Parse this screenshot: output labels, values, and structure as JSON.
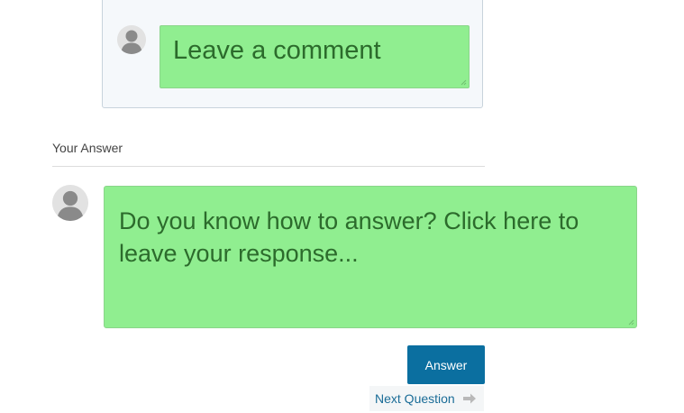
{
  "comment": {
    "placeholder": "Leave a comment"
  },
  "answer_section": {
    "title": "Your Answer",
    "placeholder": "Do you know how to answer? Click here to leave your response...",
    "submit_label": "Answer"
  },
  "navigation": {
    "next_label": "Next Question"
  },
  "colors": {
    "input_bg": "#90ee90",
    "button_bg": "#0b6fa0",
    "link": "#1a6c97"
  },
  "icons": {
    "avatar": "user-silhouette-icon",
    "next": "arrow-right-icon"
  }
}
